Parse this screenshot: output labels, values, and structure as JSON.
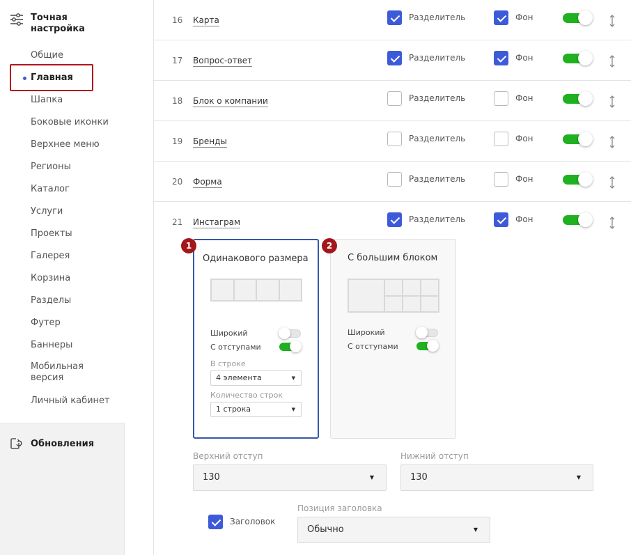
{
  "sidebar": {
    "title": "Точная настройка",
    "items": [
      {
        "label": "Общие"
      },
      {
        "label": "Главная",
        "active": true
      },
      {
        "label": "Шапка"
      },
      {
        "label": "Боковые иконки"
      },
      {
        "label": "Верхнее меню"
      },
      {
        "label": "Регионы"
      },
      {
        "label": "Каталог"
      },
      {
        "label": "Услуги"
      },
      {
        "label": "Проекты"
      },
      {
        "label": "Галерея"
      },
      {
        "label": "Корзина"
      },
      {
        "label": "Разделы"
      },
      {
        "label": "Футер"
      },
      {
        "label": "Баннеры"
      },
      {
        "label": "Мобильная версия"
      },
      {
        "label": "Личный кабинет"
      }
    ],
    "updates_label": "Обновления"
  },
  "blocks": [
    {
      "num": "16",
      "name": "Карта",
      "separator": true,
      "background": true,
      "enabled": true
    },
    {
      "num": "17",
      "name": "Вопрос-ответ",
      "separator": true,
      "background": true,
      "enabled": true
    },
    {
      "num": "18",
      "name": "Блок о компании",
      "separator": false,
      "background": false,
      "enabled": true
    },
    {
      "num": "19",
      "name": "Бренды",
      "separator": false,
      "background": false,
      "enabled": true
    },
    {
      "num": "20",
      "name": "Форма",
      "separator": false,
      "background": false,
      "enabled": true
    },
    {
      "num": "21",
      "name": "Инстаграм",
      "separator": true,
      "background": true,
      "enabled": true
    }
  ],
  "labels": {
    "separator": "Разделитель",
    "background": "Фон"
  },
  "layouts": [
    {
      "badge": "1",
      "title": "Одинакового размера",
      "selected": true,
      "wide_label": "Широкий",
      "wide": false,
      "padding_label": "С отступами",
      "padding": true,
      "per_row_label": "В строке",
      "per_row_value": "4 элемента",
      "rows_label": "Количество строк",
      "rows_value": "1 строка"
    },
    {
      "badge": "2",
      "title": "С большим блоком",
      "selected": false,
      "wide_label": "Широкий",
      "wide": false,
      "padding_label": "С отступами",
      "padding": true
    }
  ],
  "spacing": {
    "top_label": "Верхний отступ",
    "top_value": "130",
    "bottom_label": "Нижний отступ",
    "bottom_value": "130"
  },
  "heading": {
    "checkbox_label": "Заголовок",
    "checked": true,
    "position_label": "Позиция заголовка",
    "position_value": "Обычно"
  },
  "colors": {
    "accent": "#3d5bd9",
    "toggle_on": "#20b121",
    "badge": "#a3171c",
    "active_frame": "#b3151b"
  },
  "icons": {
    "settings": "sliders-icon",
    "updates": "refresh-document-icon",
    "drag": "drag-handle-icon",
    "dropdown": "caret-down-icon"
  }
}
